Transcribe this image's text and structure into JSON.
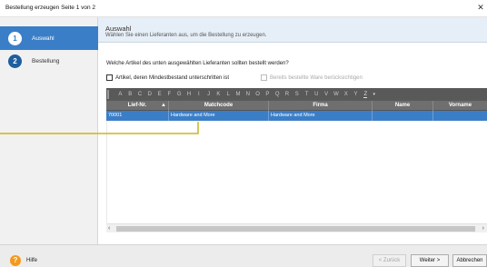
{
  "window": {
    "title": "Bestellung erzeugen Seite 1 von 2",
    "close_glyph": "✕"
  },
  "steps": [
    {
      "number": "1",
      "label": "Auswahl",
      "active": true
    },
    {
      "number": "2",
      "label": "Bestellung",
      "active": false
    }
  ],
  "header": {
    "title": "Auswahl",
    "subtitle": "Wählen Sie einen Lieferanten aus, um die Bestellung zu erzeugen."
  },
  "question": "Welche Artikel des unten ausgewählten Lieferanten sollten bestellt werden?",
  "checkboxes": [
    {
      "label": "Artikel, deren  Mindestbestand unterschritten ist",
      "checked": false,
      "enabled": true
    },
    {
      "label": "Bereits bestellte Ware berücksichtigen",
      "checked": false,
      "enabled": false
    }
  ],
  "alphabet": [
    "A",
    "B",
    "C",
    "D",
    "E",
    "F",
    "G",
    "H",
    "I",
    "J",
    "K",
    "L",
    "M",
    "N",
    "O",
    "P",
    "Q",
    "R",
    "S",
    "T",
    "U",
    "V",
    "W",
    "X",
    "Y",
    "Z"
  ],
  "alphabet_filter_glyph": "▾",
  "table": {
    "columns": [
      "Lief-Nr.",
      "Matchcode",
      "Firma",
      "Name",
      "Vorname"
    ],
    "sort_glyph": "▲",
    "rows": [
      {
        "cells": [
          "70001",
          "Hardware and More",
          "Hardware and More",
          "",
          ""
        ],
        "selected": true
      }
    ]
  },
  "scrollbar": {
    "left_glyph": "‹",
    "right_glyph": "›"
  },
  "footer": {
    "help_icon": "?",
    "help_label": "Hilfe",
    "back_label": "< Zurück",
    "next_label": "Weiter >",
    "cancel_label": "Abbrechen"
  },
  "colors": {
    "accent": "#3a7ec8",
    "callout": "#c8b51e",
    "help": "#f39a1c"
  }
}
